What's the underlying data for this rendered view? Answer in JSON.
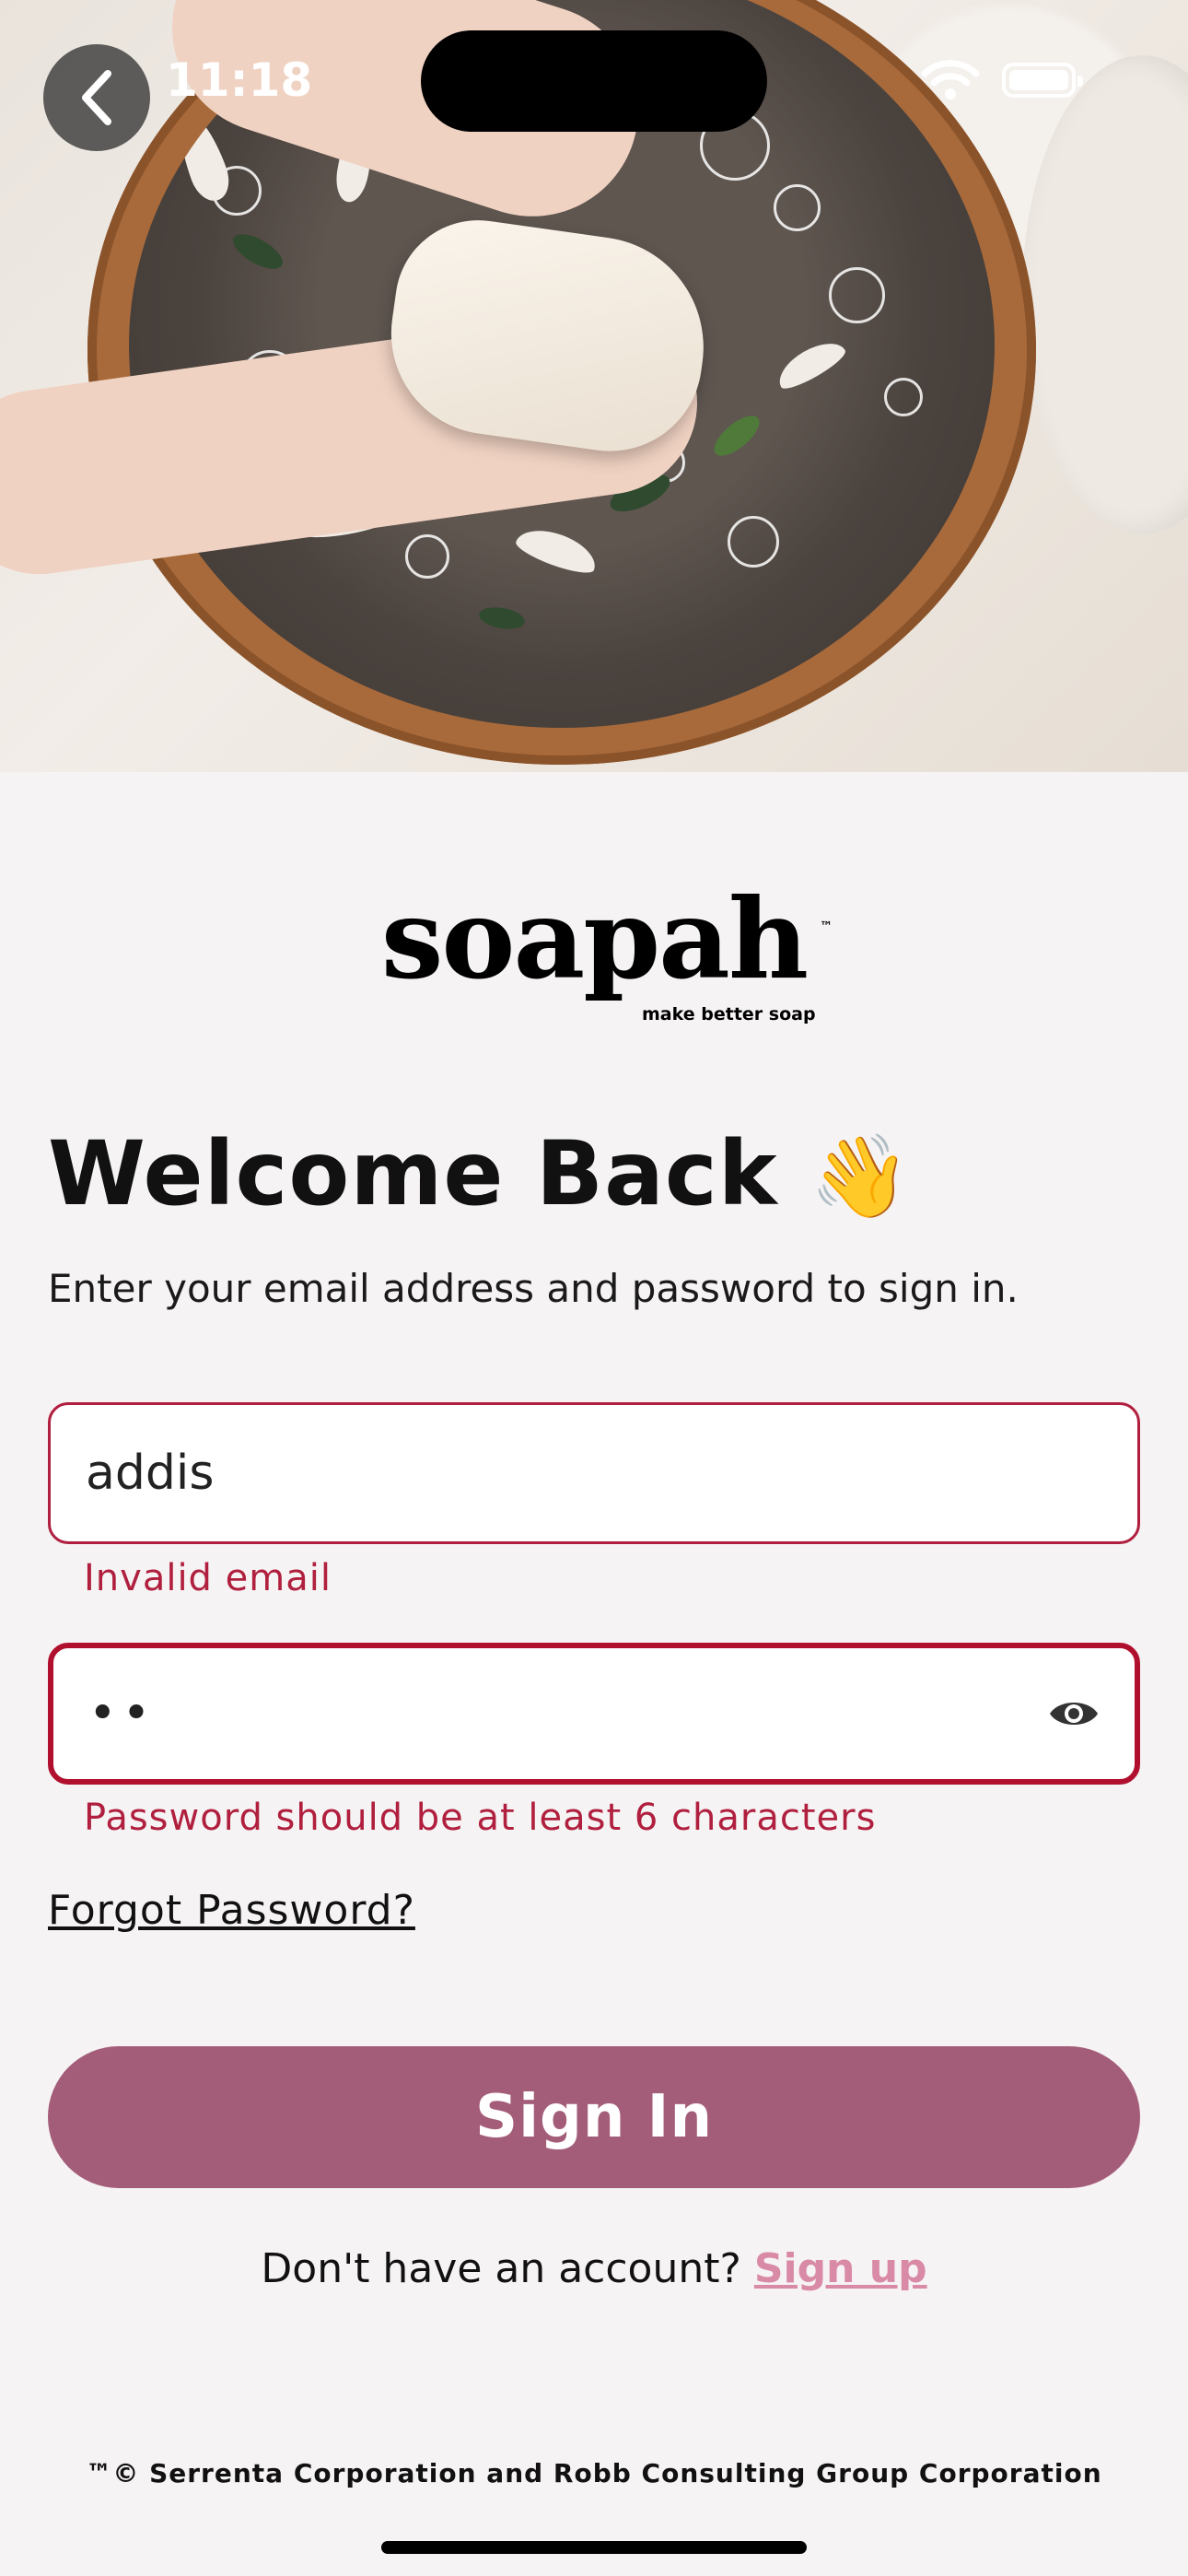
{
  "status_bar": {
    "time": "11:18"
  },
  "logo": {
    "word": "soapah",
    "tagline": "make better soap",
    "tm": "™"
  },
  "header": {
    "title": "Welcome Back",
    "emoji": "👋",
    "subtitle": "Enter your email address and password to sign in."
  },
  "form": {
    "email": {
      "value": "addis",
      "error": "Invalid email"
    },
    "password": {
      "value": "••",
      "error": "Password should be at least 6 characters"
    },
    "forgot_label": "Forgot Password?",
    "submit_label": "Sign In"
  },
  "signup": {
    "prompt": "Don't have an account?",
    "link": "Sign up"
  },
  "footer": {
    "text": "™© Serrenta Corporation and Robb Consulting Group Corporation"
  },
  "colors": {
    "accent": "#a45d79",
    "error": "#b01f3e",
    "link": "#d98aa6",
    "background": "#f6f3f4"
  }
}
